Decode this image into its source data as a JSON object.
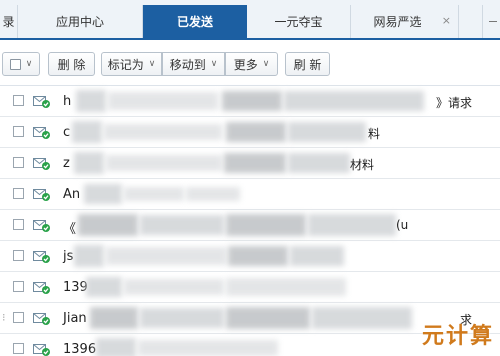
{
  "tabs": [
    {
      "label": "录",
      "active": false
    },
    {
      "label": "应用中心",
      "active": false
    },
    {
      "label": "已发送",
      "active": true
    },
    {
      "label": "一元夺宝",
      "active": false
    },
    {
      "label": "网易严选",
      "active": false,
      "closable": true
    }
  ],
  "tab_close_glyph": "×",
  "toolbar": {
    "select_chevron": "∨",
    "delete_label": "删 除",
    "mark_label": "标记为",
    "move_label": "移动到",
    "more_label": "更多",
    "refresh_label": "刷 新",
    "chevron": "∨"
  },
  "rows": [
    {
      "sender": "h",
      "subject_tail": "》请求"
    },
    {
      "sender": "c",
      "subject_tail": "料"
    },
    {
      "sender": "z",
      "subject_tail": "材料"
    },
    {
      "sender": "An",
      "subject_tail": ""
    },
    {
      "sender": "《",
      "subject_tail": "(u"
    },
    {
      "sender": "js",
      "subject_tail": ""
    },
    {
      "sender": "139",
      "subject_tail": ""
    },
    {
      "sender": "Jian",
      "subject_tail": "求"
    },
    {
      "sender": "1396",
      "subject_tail": ""
    }
  ],
  "watermark": "元计算",
  "colors": {
    "accent": "#1c5fa2",
    "mail_icon_check": "#2aa24a"
  }
}
